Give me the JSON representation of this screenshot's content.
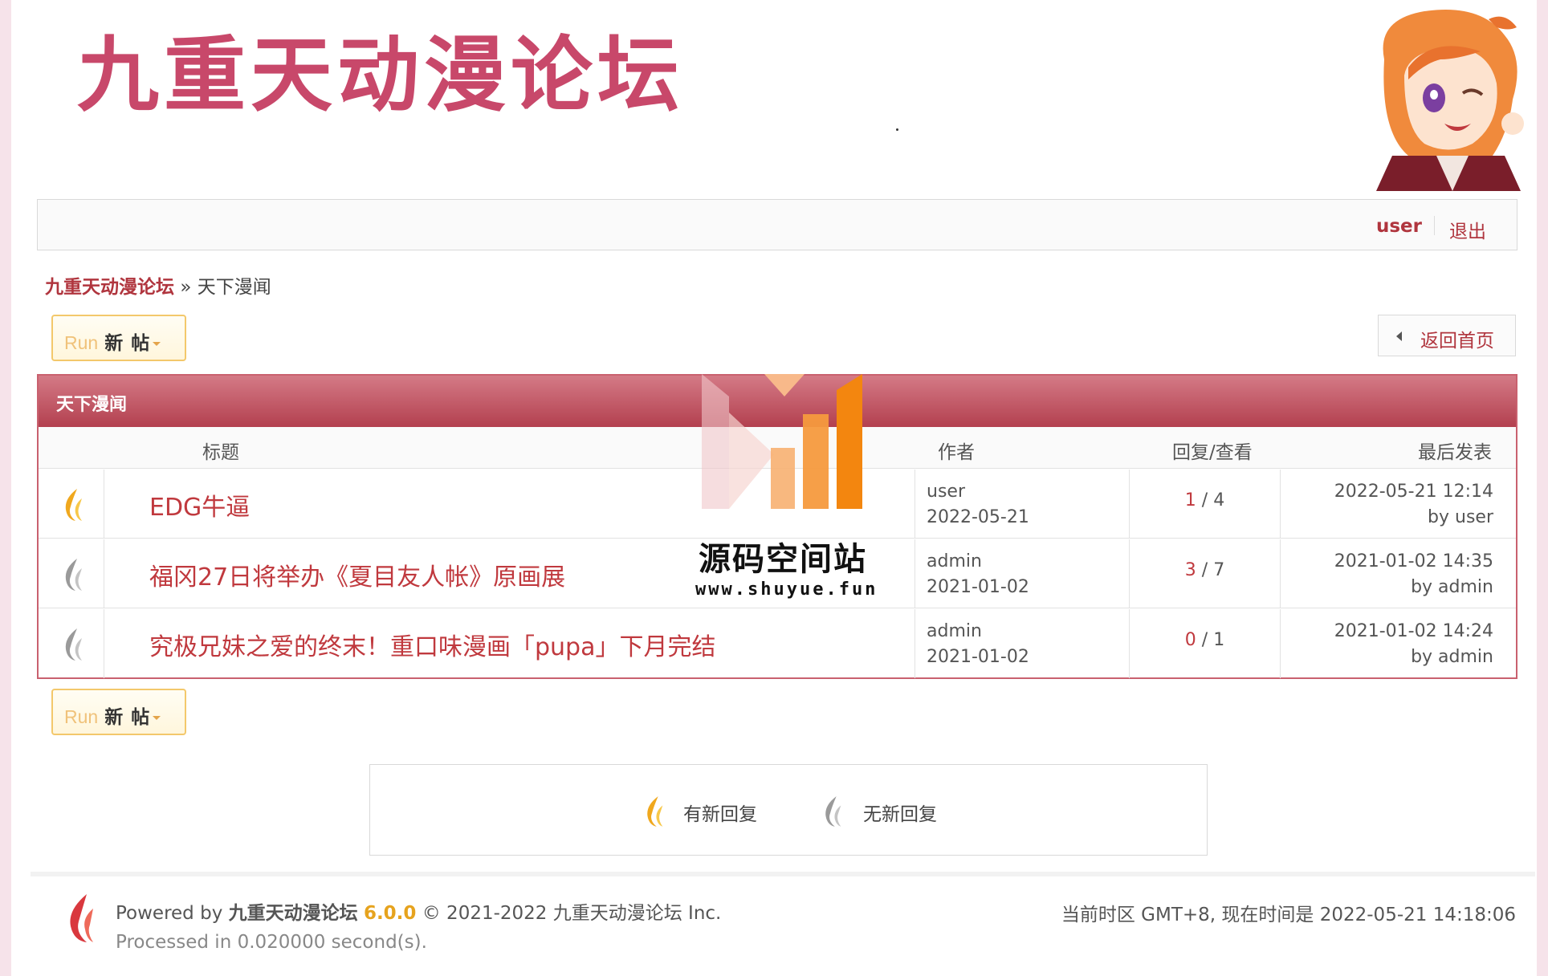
{
  "header": {
    "logo_text": "九重天动漫论坛"
  },
  "userbar": {
    "username": "user",
    "logout": "退出"
  },
  "breadcrumb": {
    "home": "九重天动漫论坛",
    "separator": "»",
    "current": "天下漫闻"
  },
  "actions": {
    "newpost_prefix": "Run",
    "newpost_label": "新帖",
    "back_home": "返回首页"
  },
  "forum": {
    "name": "天下漫闻",
    "columns": {
      "title": "标题",
      "author": "作者",
      "stats": "回复/查看",
      "last": "最后发表"
    },
    "threads": [
      {
        "title": "EDG牛逼",
        "author": "user",
        "date": "2022-05-21",
        "replies": "1",
        "views": "4",
        "last_time": "2022-05-21 12:14",
        "last_by": "by user",
        "new": true
      },
      {
        "title": "福冈27日将举办《夏目友人帐》原画展",
        "author": "admin",
        "date": "2021-01-02",
        "replies": "3",
        "views": "7",
        "last_time": "2021-01-02 14:35",
        "last_by": "by admin",
        "new": false
      },
      {
        "title": "究极兄妹之爱的终末！重口味漫画「pupa」下月完结",
        "author": "admin",
        "date": "2021-01-02",
        "replies": "0",
        "views": "1",
        "last_time": "2021-01-02 14:24",
        "last_by": "by admin",
        "new": false
      }
    ]
  },
  "legend": {
    "new_reply": "有新回复",
    "no_new_reply": "无新回复"
  },
  "watermark": {
    "title": "源码空间站",
    "url": "www.shuyue.fun"
  },
  "footer": {
    "powered_prefix": "Powered by",
    "forum_name": "九重天动漫论坛",
    "version": "6.0.0",
    "copyright": "© 2021-2022 九重天动漫论坛 Inc.",
    "processed": "Processed in 0.020000 second(s).",
    "timezone": "当前时区 GMT+8, 现在时间是 2022-05-21 14:18:06"
  },
  "colors": {
    "brand": "#c8486a",
    "link": "#b0353e",
    "header_bar": "#b3404f",
    "flame_new": "#f0a81e",
    "flame_old": "#9a9a9a"
  }
}
